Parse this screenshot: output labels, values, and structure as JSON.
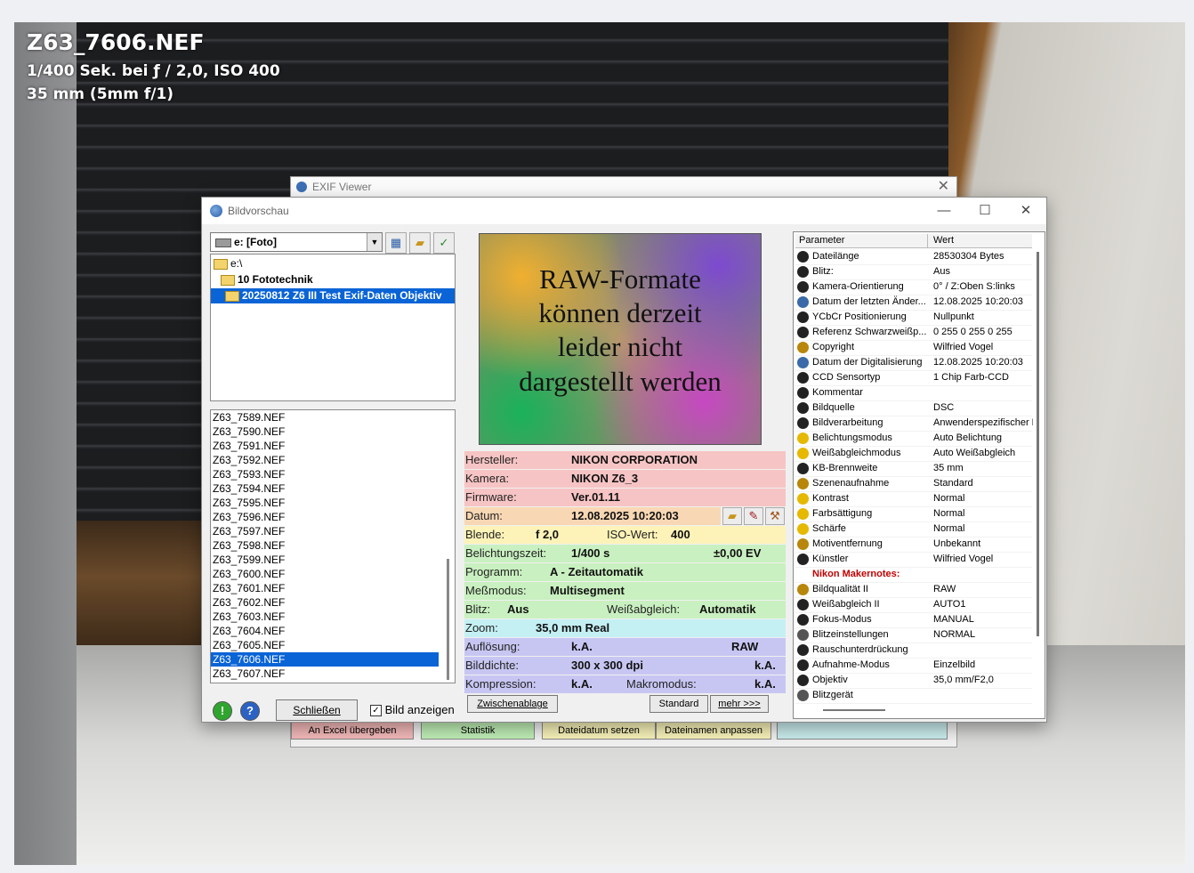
{
  "overlay": {
    "filename": "Z63_7606.NEF",
    "exposure": "1/400 Sek. bei ƒ / 2,0, ISO 400",
    "lens": "35 mm (5mm f/1)"
  },
  "exif_window": {
    "title": "EXIF Viewer",
    "buttons": [
      "An Excel übergeben",
      "Statistik",
      "Dateidatum setzen",
      "Dateinamen anpassen"
    ]
  },
  "dialog": {
    "title": "Bildvorschau",
    "drive": "e: [Foto]",
    "tree": [
      "e:\\",
      "10 Fototechnik",
      "20250812 Z6 III Test Exif-Daten Objektiv"
    ],
    "files": [
      "Z63_7589.NEF",
      "Z63_7590.NEF",
      "Z63_7591.NEF",
      "Z63_7592.NEF",
      "Z63_7593.NEF",
      "Z63_7594.NEF",
      "Z63_7595.NEF",
      "Z63_7596.NEF",
      "Z63_7597.NEF",
      "Z63_7598.NEF",
      "Z63_7599.NEF",
      "Z63_7600.NEF",
      "Z63_7601.NEF",
      "Z63_7602.NEF",
      "Z63_7603.NEF",
      "Z63_7604.NEF",
      "Z63_7605.NEF",
      "Z63_7606.NEF",
      "Z63_7607.NEF"
    ],
    "selected_file": "Z63_7606.NEF",
    "close_button": "Schließen",
    "show_image_label": "Bild anzeigen",
    "show_image_checked": true,
    "preview_text": [
      "RAW-Formate",
      "können derzeit",
      "leider nicht",
      "dargestellt werden"
    ],
    "info": {
      "hersteller_label": "Hersteller:",
      "hersteller": "NIKON CORPORATION",
      "kamera_label": "Kamera:",
      "kamera": "NIKON Z6_3",
      "firmware_label": "Firmware:",
      "firmware": "Ver.01.11",
      "datum_label": "Datum:",
      "datum": "12.08.2025 10:20:03",
      "blende_label": "Blende:",
      "blende": "f 2,0",
      "iso_label": "ISO-Wert:",
      "iso": "400",
      "belichtung_label": "Belichtungszeit:",
      "belichtung": "1/400 s",
      "ev": "±0,00 EV",
      "programm_label": "Programm:",
      "programm": "A - Zeitautomatik",
      "messmodus_label": "Meßmodus:",
      "messmodus": "Multisegment",
      "blitz_label": "Blitz:",
      "blitz": "Aus",
      "wb_label": "Weißabgleich:",
      "wb": "Automatik",
      "zoom_label": "Zoom:",
      "zoom": "35,0 mm Real",
      "aufloesung_label": "Auflösung:",
      "aufloesung": "k.A.",
      "aufloesung2": "RAW",
      "bilddichte_label": "Bilddichte:",
      "bilddichte": "300 x 300 dpi",
      "bilddichte2": "k.A.",
      "kompression_label": "Kompression:",
      "kompression": "k.A.",
      "makro_label": "Makromodus:",
      "makro": "k.A."
    },
    "buttons": {
      "clipboard": "Zwischenablage",
      "standard": "Standard",
      "more": "mehr >>>"
    },
    "table_headers": {
      "param": "Parameter",
      "value": "Wert"
    },
    "params": [
      {
        "k": "Dateilänge",
        "v": "28530304 Bytes",
        "c": "#222"
      },
      {
        "k": "Blitz:",
        "v": "Aus",
        "c": "#222"
      },
      {
        "k": "Kamera-Orientierung",
        "v": "0° / Z:Oben S:links",
        "c": "#222"
      },
      {
        "k": "Datum der letzten Änder...",
        "v": "12.08.2025 10:20:03",
        "c": "#3a6ba8"
      },
      {
        "k": "YCbCr Positionierung",
        "v": "Nullpunkt",
        "c": "#222"
      },
      {
        "k": "Referenz Schwarzweißp...",
        "v": "0 255 0 255 0 255",
        "c": "#222"
      },
      {
        "k": "Copyright",
        "v": "Wilfried Vogel",
        "c": "#b8860b"
      },
      {
        "k": "Datum der Digitalisierung",
        "v": "12.08.2025 10:20:03",
        "c": "#3a6ba8"
      },
      {
        "k": "CCD Sensortyp",
        "v": "1 Chip Farb-CCD",
        "c": "#222"
      },
      {
        "k": "Kommentar",
        "v": "",
        "c": "#222"
      },
      {
        "k": "Bildquelle",
        "v": "DSC",
        "c": "#222"
      },
      {
        "k": "Bildverarbeitung",
        "v": "Anwenderspezifischer P",
        "c": "#222"
      },
      {
        "k": "Belichtungsmodus",
        "v": "Auto Belichtung",
        "c": "#e6b800"
      },
      {
        "k": "Weißabgleichmodus",
        "v": "Auto Weißabgleich",
        "c": "#e6b800"
      },
      {
        "k": "KB-Brennweite",
        "v": "35 mm",
        "c": "#222"
      },
      {
        "k": "Szenenaufnahme",
        "v": "Standard",
        "c": "#b8860b"
      },
      {
        "k": "Kontrast",
        "v": "Normal",
        "c": "#e6b800"
      },
      {
        "k": "Farbsättigung",
        "v": "Normal",
        "c": "#e6b800"
      },
      {
        "k": "Schärfe",
        "v": "Normal",
        "c": "#e6b800"
      },
      {
        "k": "Motiventfernung",
        "v": "Unbekannt",
        "c": "#b8860b"
      },
      {
        "k": "Künstler",
        "v": "Wilfried Vogel",
        "c": "#222"
      },
      {
        "k": "Nikon Makernotes:",
        "v": "",
        "c": "",
        "maker": true
      },
      {
        "k": "Bildqualität II",
        "v": "RAW",
        "c": "#b8860b"
      },
      {
        "k": "Weißabgleich II",
        "v": "AUTO1",
        "c": "#222"
      },
      {
        "k": "Fokus-Modus",
        "v": "MANUAL",
        "c": "#222"
      },
      {
        "k": "Blitzeinstellungen",
        "v": "NORMAL",
        "c": "#555"
      },
      {
        "k": "Rauschunterdrückung",
        "v": "",
        "c": "#222"
      },
      {
        "k": "Aufnahme-Modus",
        "v": "Einzelbild",
        "c": "#222"
      },
      {
        "k": "Objektiv",
        "v": "35,0 mm/F2,0",
        "c": "#222"
      },
      {
        "k": "Blitzgerät",
        "v": "",
        "c": "#555"
      }
    ],
    "colors": {
      "red_rows": "#f6c4c4",
      "orange_row": "#f8d8b4",
      "yellow_row": "#fdf3b8",
      "green_rows": "#c9f0c0",
      "cyan_row": "#c4f0f4",
      "blue_rows": "#c7c6f2",
      "selection": "#0a64d6"
    }
  }
}
